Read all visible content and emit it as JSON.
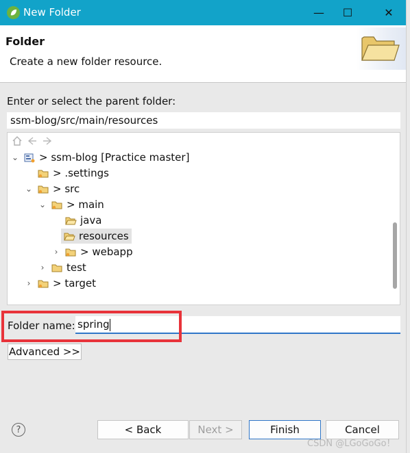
{
  "window": {
    "title": "New Folder",
    "minimize": "—",
    "maximize": "☐",
    "close": "✕"
  },
  "header": {
    "title": "Folder",
    "description": "Create a new folder resource."
  },
  "parent": {
    "label": "Enter or select the parent folder:",
    "value": "ssm-blog/src/main/resources"
  },
  "tree": {
    "toolbar": [
      "home-icon",
      "back-arrow-icon",
      "forward-arrow-icon"
    ],
    "items": [
      {
        "label": "> ssm-blog [Practice master]",
        "chevron": "⌄",
        "icon": "project"
      },
      {
        "label": "> .settings",
        "chevron": "",
        "icon": "folder"
      },
      {
        "label": "> src",
        "chevron": "⌄",
        "icon": "folder"
      },
      {
        "label": "> main",
        "chevron": "⌄",
        "icon": "folder"
      },
      {
        "label": "java",
        "chevron": "",
        "icon": "folder"
      },
      {
        "label": "resources",
        "chevron": "",
        "icon": "folder",
        "selected": true
      },
      {
        "label": "> webapp",
        "chevron": "›",
        "icon": "folder"
      },
      {
        "label": "test",
        "chevron": "›",
        "icon": "folder"
      },
      {
        "label": "> target",
        "chevron": "›",
        "icon": "folder"
      }
    ]
  },
  "folder_name": {
    "label": "Folder name:",
    "value": "spring"
  },
  "advanced_label": "Advanced >>",
  "buttons": {
    "help": "?",
    "back": "< Back",
    "next": "Next >",
    "finish": "Finish",
    "cancel": "Cancel"
  },
  "watermark": "CSDN @LGoGoGo！",
  "colors": {
    "titlebar": "#12a3c9",
    "highlight": "#e8333a",
    "focus": "#2f76c8"
  }
}
